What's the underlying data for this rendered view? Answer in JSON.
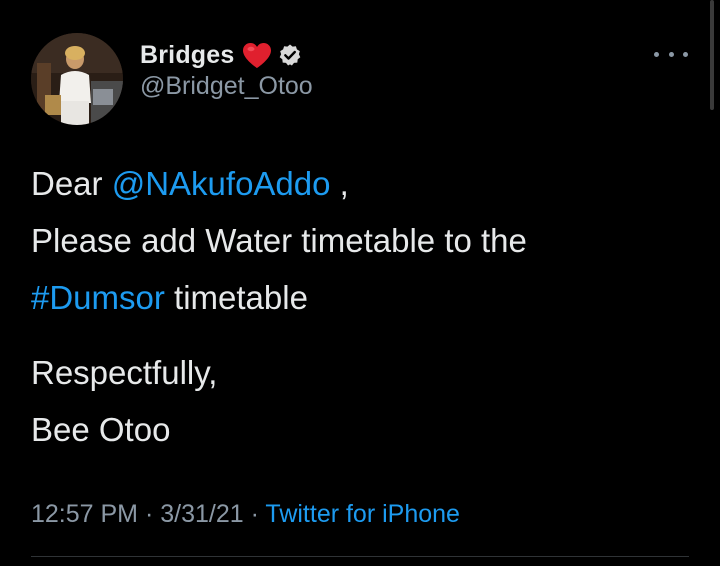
{
  "author": {
    "display_name": "Bridges",
    "handle": "@Bridget_Otoo",
    "verified": true,
    "name_emoji": "red-heart-icon"
  },
  "tweet": {
    "greeting": "Dear ",
    "mention": "@NAkufoAddo",
    "greeting_end": " ,",
    "line2": "Please add Water timetable to the",
    "hashtag": "#Dumsor",
    "line3_end": " timetable",
    "signoff": "Respectfully,",
    "signature": "Bee Otoo"
  },
  "meta": {
    "time": "12:57 PM",
    "separator": " · ",
    "date": "3/31/21",
    "separator2": " · ",
    "source": "Twitter for iPhone"
  },
  "colors": {
    "background": "#000000",
    "text": "#e7e9ea",
    "secondary": "#8b98a5",
    "link": "#1d9bf0"
  }
}
